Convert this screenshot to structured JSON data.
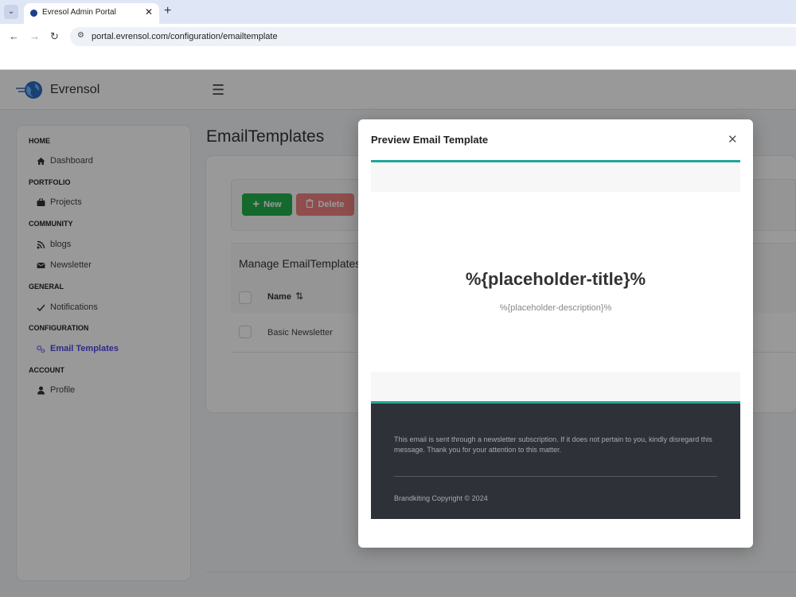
{
  "browser": {
    "tab_title": "Evresol Admin Portal",
    "url": "portal.evrensol.com/configuration/emailtemplate"
  },
  "app": {
    "brand": "Evrensol"
  },
  "sidebar": {
    "sections": {
      "home": "HOME",
      "portfolio": "PORTFOLIO",
      "community": "COMMUNITY",
      "general": "GENERAL",
      "configuration": "CONFIGURATION",
      "account": "ACCOUNT"
    },
    "items": {
      "dashboard": "Dashboard",
      "projects": "Projects",
      "blogs": "blogs",
      "newsletter": "Newsletter",
      "notifications": "Notifications",
      "email_templates": "Email Templates",
      "profile": "Profile"
    }
  },
  "main": {
    "title": "EmailTemplates",
    "new_label": "New",
    "delete_label": "Delete",
    "table_caption": "Manage EmailTemplates",
    "col_name": "Name",
    "rows": [
      "Basic Newsletter"
    ]
  },
  "modal": {
    "title": "Preview Email Template",
    "email_title": "%{placeholder-title}%",
    "email_description": "%{placeholder-description}%",
    "footer_text": "This email is sent through a newsletter subscription. If it does not pertain to you, kindly disregard this message. Thank you for your attention to this matter.",
    "footer_copyright": "Brandkiting Copyright © 2024"
  },
  "colors": {
    "accent_teal": "#1fa79a",
    "new_green": "#22b14c",
    "delete_red": "#f08080",
    "active_indigo": "#4f46e5",
    "footer_dark": "#2f3139"
  }
}
